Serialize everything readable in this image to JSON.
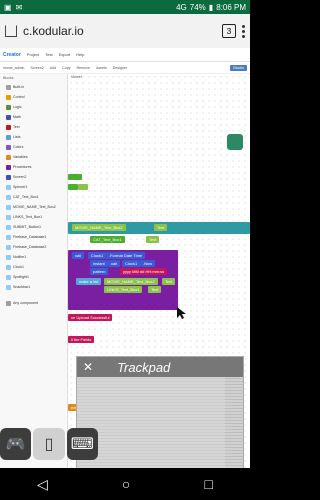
{
  "status_bar": {
    "battery": "74%",
    "time": "8:06 PM",
    "signal": "4G"
  },
  "browser": {
    "url": "c.kodular.io",
    "tab_count": "3"
  },
  "app": {
    "brand": "Creator",
    "project_menu": [
      "Project",
      "Test",
      "Export",
      "Help"
    ],
    "project_name": "movie_admin",
    "screen": "Screen2",
    "toolbar_buttons": [
      "Add",
      "Copy",
      "Remove",
      "Assets",
      "Designer",
      "Blocks"
    ],
    "panel_header": "Blocks",
    "viewer_label": "Viewer",
    "builtin": [
      "Built-in",
      "Control",
      "Logic",
      "Math",
      "Text",
      "Lists",
      "Colors",
      "Variables",
      "Procedures"
    ],
    "screen_items": [
      "Screen2",
      "Spinner1",
      "CAT_Text_Box1",
      "MOVIE_NAME_Text_Box2",
      "LINKS_Text_Box1",
      "SUBMIT_Button1",
      "Firebase_Database1",
      "Firebase_Database2",
      "Notifier1",
      "Clock1",
      "Spotlight1",
      "Snackbar1"
    ],
    "any_component": "Any component"
  },
  "blocks": {
    "b1": "MOVIE_NAME_Text_Box2",
    "b2": "Text",
    "b3": "CAT_Text_Box1",
    "b4": "Text",
    "b5": "call",
    "b6": "Clock1",
    "b7": ".Format Date Time",
    "b8": "instant",
    "b9": "call",
    "b10": "Clock1",
    "b11": ".Now",
    "b12": "pattern",
    "b13": "yyyy MM dd HH:mm:ss",
    "b14": "make a list",
    "b15": "MOVIE_NAME_Text_Box2",
    "b16": "Text",
    "b17": "LINKS_Text_Box1",
    "b18": "Text",
    "b19": "ve Upload Successful",
    "b20": "ll the Fields",
    "b21": "ection"
  },
  "trackpad": {
    "title": "Trackpad"
  },
  "colors": {
    "status_green": "#0b6b3f",
    "accent_blue": "#3b5bd6",
    "block_green": "#4cae2e",
    "block_pink": "#c2185b"
  }
}
